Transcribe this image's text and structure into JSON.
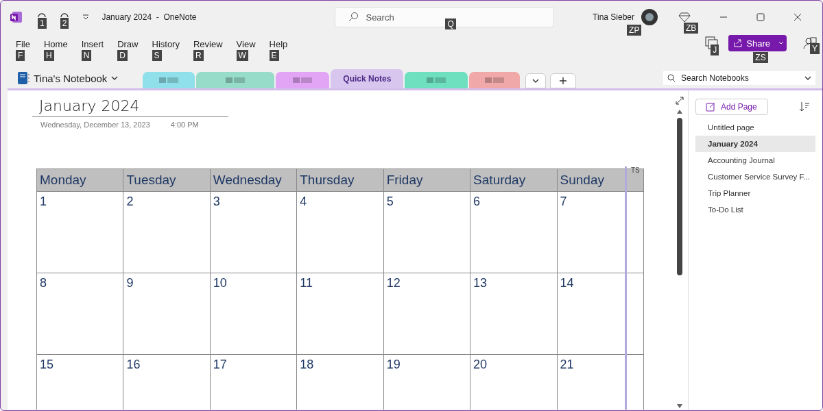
{
  "title_bar": {
    "title": "January 2024  -  OneNote",
    "undo_tip": "1",
    "redo_tip": "2",
    "search": {
      "placeholder": "Search",
      "key_tip": "Q"
    },
    "user": {
      "name": "Tina Sieber",
      "key_tip": "ZP"
    },
    "premium_tip": "ZB"
  },
  "ribbon_tabs": [
    {
      "label": "File",
      "key_tip": "F"
    },
    {
      "label": "Home",
      "key_tip": "H"
    },
    {
      "label": "Insert",
      "key_tip": "N"
    },
    {
      "label": "Draw",
      "key_tip": "D"
    },
    {
      "label": "History",
      "key_tip": "S"
    },
    {
      "label": "Review",
      "key_tip": "R"
    },
    {
      "label": "View",
      "key_tip": "W"
    },
    {
      "label": "Help",
      "key_tip": "E"
    }
  ],
  "ribbon_right": {
    "sticky_tip": "J",
    "share": {
      "label": "Share",
      "key_tip": "ZS"
    },
    "profile_tip": "Y"
  },
  "notebook": {
    "name": "Tina's Notebook"
  },
  "sections": [
    {
      "color": "#8fe0ea",
      "selected": false
    },
    {
      "color": "#97dcc8",
      "selected": false
    },
    {
      "color": "#e2a4f5",
      "selected": false
    },
    {
      "label": "Quick Notes",
      "color": "#d9c6ef",
      "selected": true
    },
    {
      "color": "#6ee0c0",
      "selected": false
    },
    {
      "color": "#f0a8a8",
      "selected": false
    }
  ],
  "search_notebooks": {
    "placeholder": "Search Notebooks"
  },
  "page": {
    "title": "January 2024",
    "date": "Wednesday, December 13, 2023",
    "time": "4:00 PM",
    "author_tag": "TS",
    "calendar": {
      "columns": [
        "Monday",
        "Tuesday",
        "Wednesday",
        "Thursday",
        "Friday",
        "Saturday",
        "Sunday"
      ],
      "rows": [
        [
          "1",
          "2",
          "3",
          "4",
          "5",
          "6",
          "7"
        ],
        [
          "8",
          "9",
          "10",
          "11",
          "12",
          "13",
          "14"
        ],
        [
          "15",
          "16",
          "17",
          "18",
          "19",
          "20",
          "21"
        ]
      ]
    }
  },
  "pages_panel": {
    "add_label": "Add Page",
    "pages": [
      {
        "label": "Untitled page",
        "selected": false
      },
      {
        "label": "January 2024",
        "selected": true
      },
      {
        "label": "Accounting Journal",
        "selected": false
      },
      {
        "label": "Customer Service Survey F...",
        "selected": false
      },
      {
        "label": "Trip Planner",
        "selected": false
      },
      {
        "label": "To-Do List",
        "selected": false
      }
    ]
  }
}
